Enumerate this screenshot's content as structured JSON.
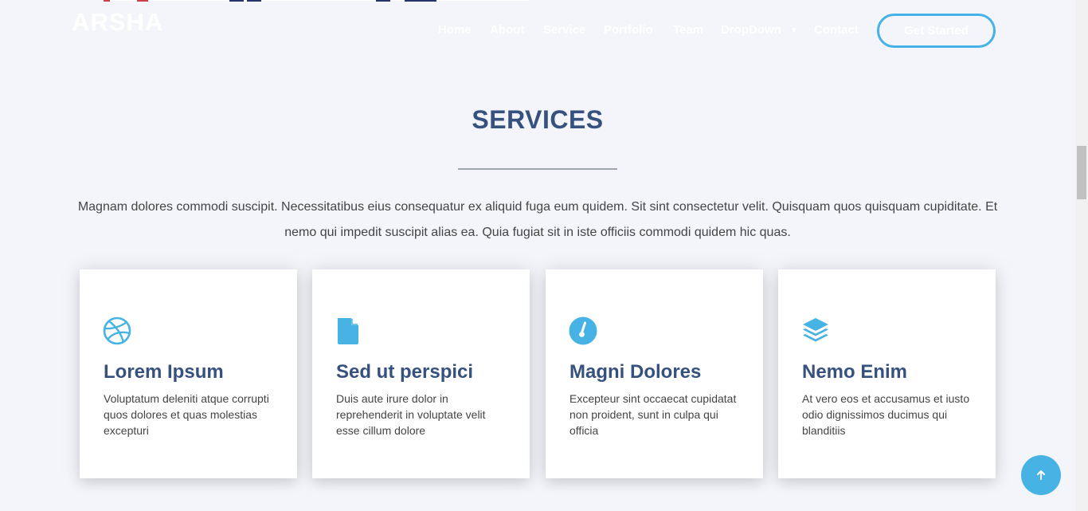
{
  "header": {
    "logo": "ARSHA",
    "nav": [
      {
        "label": "Home"
      },
      {
        "label": "About"
      },
      {
        "label": "Service"
      },
      {
        "label": "Portfolio"
      },
      {
        "label": "Team"
      },
      {
        "label": "DropDown"
      },
      {
        "label": "Contact"
      }
    ],
    "cta_label": "Get Started"
  },
  "section": {
    "title": "SERVICES",
    "description": "Magnam dolores commodi suscipit. Necessitatibus eius consequatur ex aliquid fuga eum quidem. Sit sint consectetur velit. Quisquam quos quisquam cupiditate. Et nemo qui impedit suscipit alias ea. Quia fugiat sit in iste officiis commodi quidem hic quas."
  },
  "services": [
    {
      "icon": "dribbble-icon",
      "title": "Lorem Ipsum",
      "text": "Voluptatum deleniti atque corrupti quos dolores et quas molestias excepturi"
    },
    {
      "icon": "file-icon",
      "title": "Sed ut perspici",
      "text": "Duis aute irure dolor in reprehenderit in voluptate velit esse cillum dolore"
    },
    {
      "icon": "speedometer-icon",
      "title": "Magni Dolores",
      "text": "Excepteur sint occaecat cupidatat non proident, sunt in culpa qui officia"
    },
    {
      "icon": "layers-icon",
      "title": "Nemo Enim",
      "text": "At vero eos et accusamus et iusto odio dignissimos ducimus qui blanditiis"
    }
  ],
  "colors": {
    "accent": "#47b2e4",
    "heading": "#37517e",
    "background": "#f3f5fa",
    "text": "#444444"
  }
}
